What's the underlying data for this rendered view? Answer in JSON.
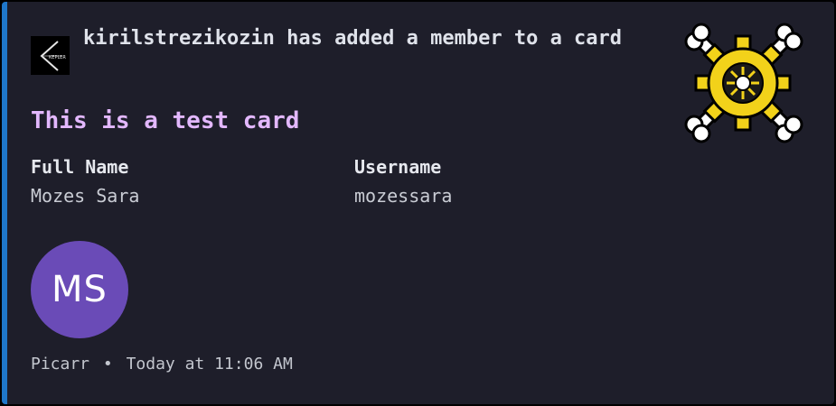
{
  "author": {
    "name": "kirilstrezikozin",
    "action": "has added a member to a card",
    "avatar_icon": "kepler-logo-icon"
  },
  "title": "This is a test card",
  "fields": [
    {
      "name": "Full Name",
      "value": "Mozes Sara"
    },
    {
      "name": "Username",
      "value": "mozessara"
    }
  ],
  "member": {
    "initials": "MS",
    "color": "#6a4bb7"
  },
  "thumbnail_icon": "gear-crossbones-icon",
  "footer": {
    "source": "Picarr",
    "separator": "•",
    "timestamp": "Today at 11:06 AM"
  },
  "colors": {
    "accent": "#1f77c9",
    "background": "#1e1e2a",
    "title": "#e3b8ff"
  }
}
